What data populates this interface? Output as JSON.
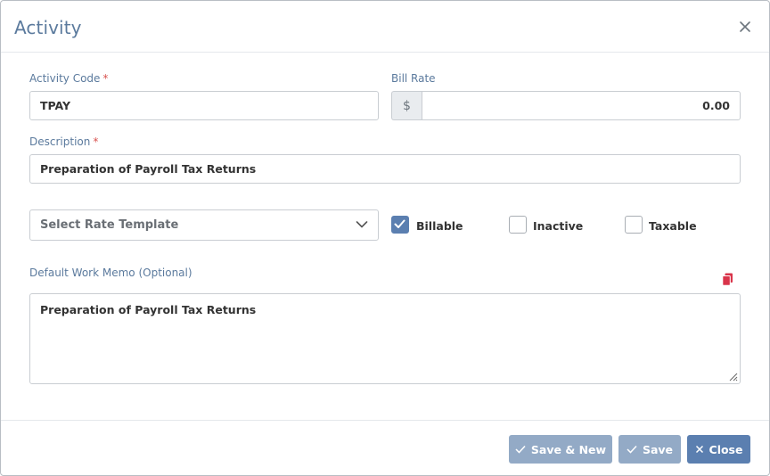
{
  "modal": {
    "title": "Activity"
  },
  "form": {
    "activity_code": {
      "label": "Activity Code",
      "required_mark": "*",
      "value": "TPAY"
    },
    "bill_rate": {
      "label": "Bill Rate",
      "currency_symbol": "$",
      "value": "0.00"
    },
    "description": {
      "label": "Description",
      "required_mark": "*",
      "value": "Preparation of Payroll Tax Returns"
    },
    "rate_template": {
      "placeholder": "Select Rate Template"
    },
    "checkboxes": [
      {
        "label": "Billable",
        "checked": true
      },
      {
        "label": "Inactive",
        "checked": false
      },
      {
        "label": "Taxable",
        "checked": false
      }
    ],
    "work_memo": {
      "label": "Default Work Memo (Optional)",
      "value": "Preparation of Payroll Tax Returns"
    }
  },
  "footer": {
    "save_new_label": "Save & New",
    "save_label": "Save",
    "close_label": "Close"
  },
  "colors": {
    "accent": "#5b7fb0",
    "button_light": "#93aac6",
    "label": "#5b7a9d",
    "required": "#d9534f",
    "copy_icon": "#d9344a"
  }
}
